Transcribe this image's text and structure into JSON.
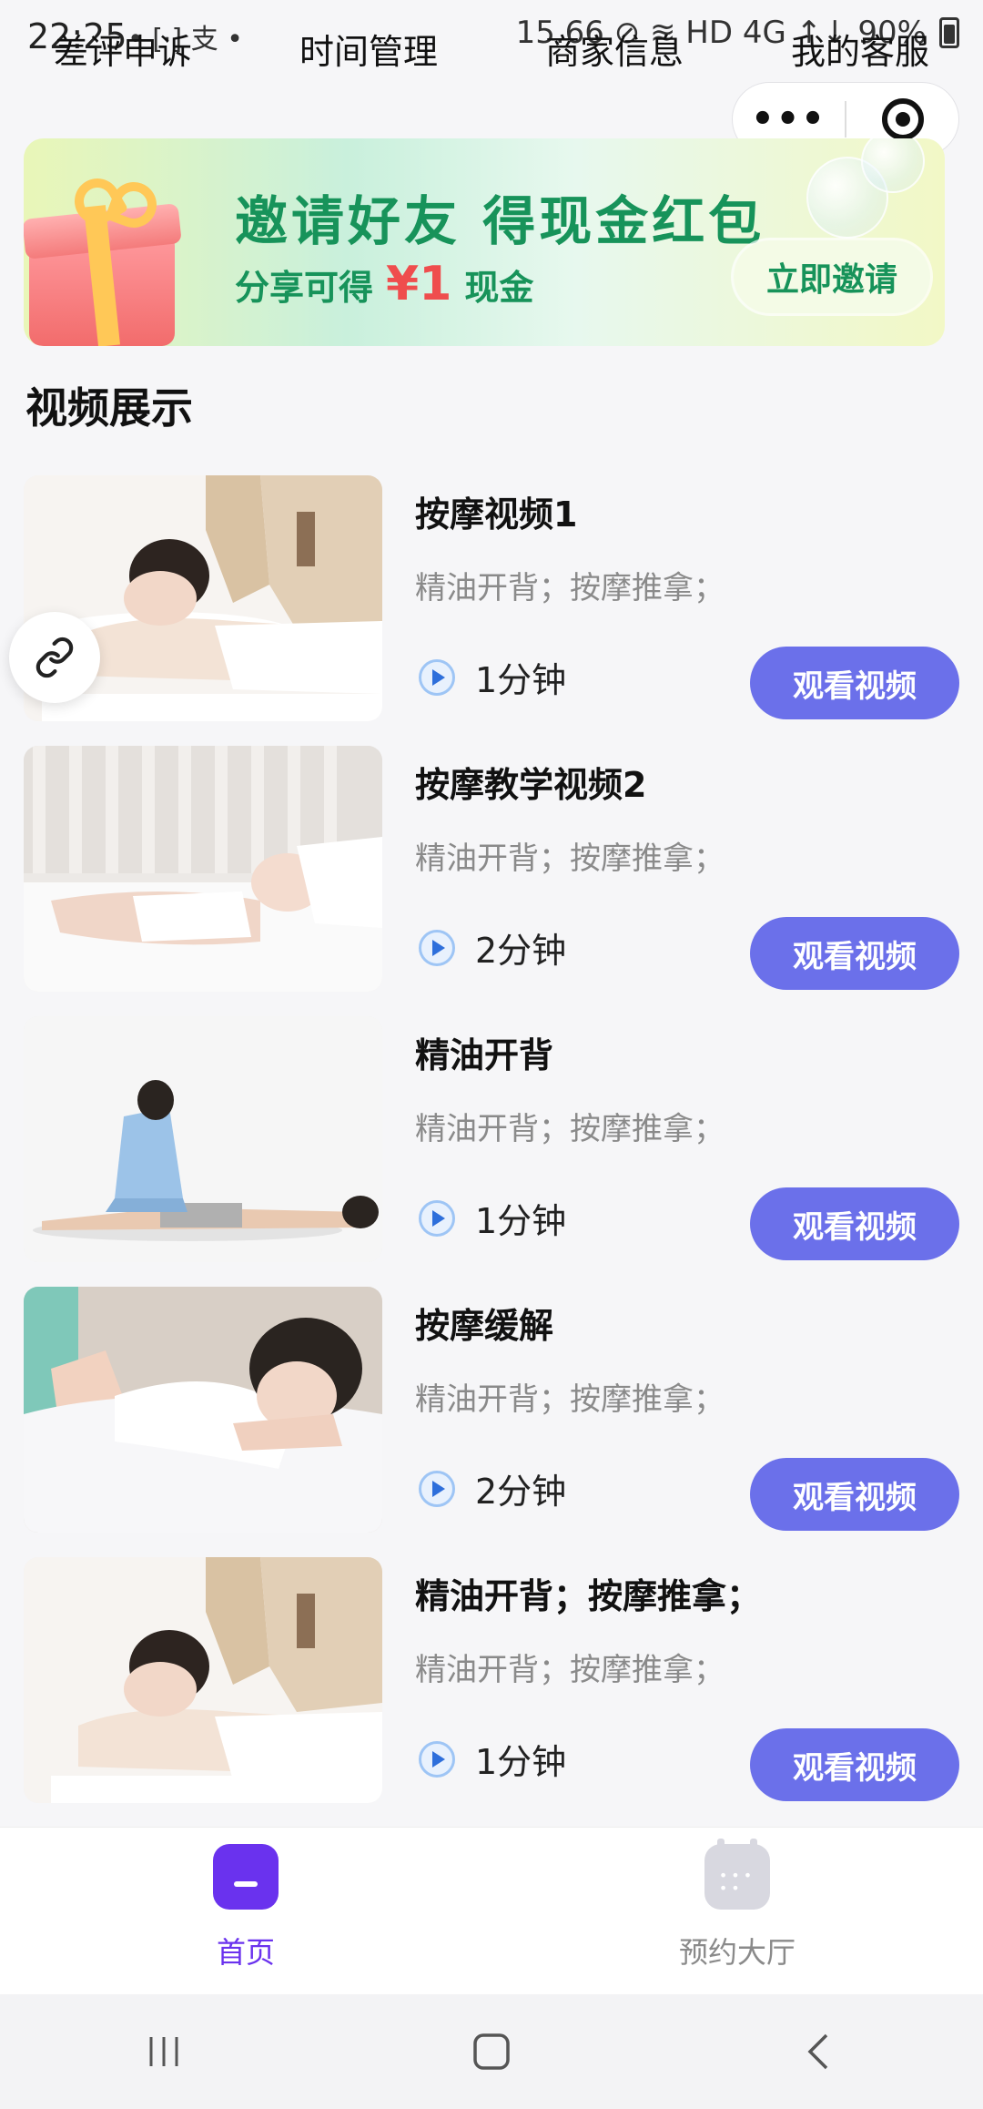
{
  "status_bar": {
    "time": "22:25",
    "left_icons": "• [·] 支 •",
    "right_text": "15.66  ⊘  ≋  HD 4G ↑↓  90%"
  },
  "top_nav": {
    "items": [
      "差评申诉",
      "时间管理",
      "商家信息",
      "我的客服"
    ]
  },
  "capsule": {
    "more": "•••"
  },
  "banner": {
    "title": "邀请好友 得现金红包",
    "sub_prefix": "分享可得",
    "sub_amount": "¥1",
    "sub_suffix": "现金",
    "button": "立即邀请"
  },
  "section": {
    "title": "视频展示"
  },
  "videos": [
    {
      "title": "按摩视频1",
      "desc": "精油开背；按摩推拿；",
      "duration": "1分钟",
      "button": "观看视频"
    },
    {
      "title": "按摩教学视频2",
      "desc": "精油开背；按摩推拿；",
      "duration": "2分钟",
      "button": "观看视频"
    },
    {
      "title": "精油开背",
      "desc": "精油开背；按摩推拿；",
      "duration": "1分钟",
      "button": "观看视频"
    },
    {
      "title": "按摩缓解",
      "desc": "精油开背；按摩推拿；",
      "duration": "2分钟",
      "button": "观看视频"
    },
    {
      "title": "精油开背；按摩推拿；",
      "desc": "精油开背；按摩推拿；",
      "duration": "1分钟",
      "button": "观看视频"
    }
  ],
  "tabbar": {
    "home": "首页",
    "booking": "预约大厅",
    "active_color": "#6a32ee",
    "inactive_color": "#8a8a8a"
  },
  "colors": {
    "accent_button": "#6b70ea",
    "banner_green": "#17935a",
    "banner_red": "#ef4d4d"
  }
}
